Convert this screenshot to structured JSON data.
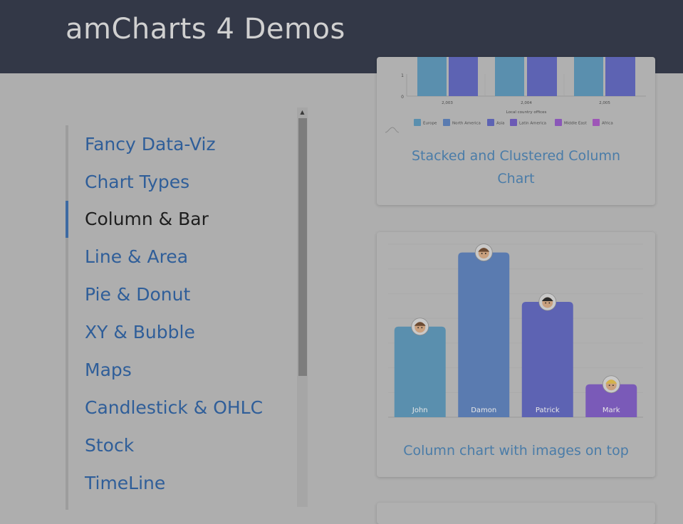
{
  "header": {
    "title": "amCharts 4 Demos"
  },
  "sidebar": {
    "items": [
      {
        "label": "Fancy Data-Viz",
        "active": false
      },
      {
        "label": "Chart Types",
        "active": false
      },
      {
        "label": "Column & Bar",
        "active": true
      },
      {
        "label": "Line & Area",
        "active": false
      },
      {
        "label": "Pie & Donut",
        "active": false
      },
      {
        "label": "XY & Bubble",
        "active": false
      },
      {
        "label": "Maps",
        "active": false
      },
      {
        "label": "Candlestick & OHLC",
        "active": false
      },
      {
        "label": "Stock",
        "active": false
      },
      {
        "label": "TimeLine",
        "active": false
      }
    ]
  },
  "cards": [
    {
      "caption": "Stacked and Clustered Column Chart",
      "caption_lines": [
        "Stacked and Clustered Column",
        "Chart"
      ],
      "chart": {
        "y_ticks": [
          "1",
          "0"
        ],
        "x_labels": [
          "2,003",
          "2,004",
          "2,005"
        ],
        "x_axis_title": "Local country offices",
        "legend": [
          "Europe",
          "North America",
          "Asia",
          "Latin America",
          "Middle East",
          "Africa"
        ],
        "legend_colors": [
          "#5a8fae",
          "#5a7bb0",
          "#5d63b3",
          "#6c5ab5",
          "#8a57b8",
          "#9e56b7"
        ]
      }
    },
    {
      "caption": "Column chart with images on top"
    }
  ],
  "chart_data": {
    "type": "bar",
    "title": "",
    "xlabel": "",
    "ylabel": "",
    "categories": [
      "John",
      "Damon",
      "Patrick",
      "Mark"
    ],
    "values": [
      55,
      100,
      70,
      20
    ],
    "ylim": [
      0,
      105
    ],
    "colors": [
      "#5a8fae",
      "#5a7bb0",
      "#5d63b3",
      "#7a5ab8"
    ],
    "grid": true,
    "legend": false
  }
}
